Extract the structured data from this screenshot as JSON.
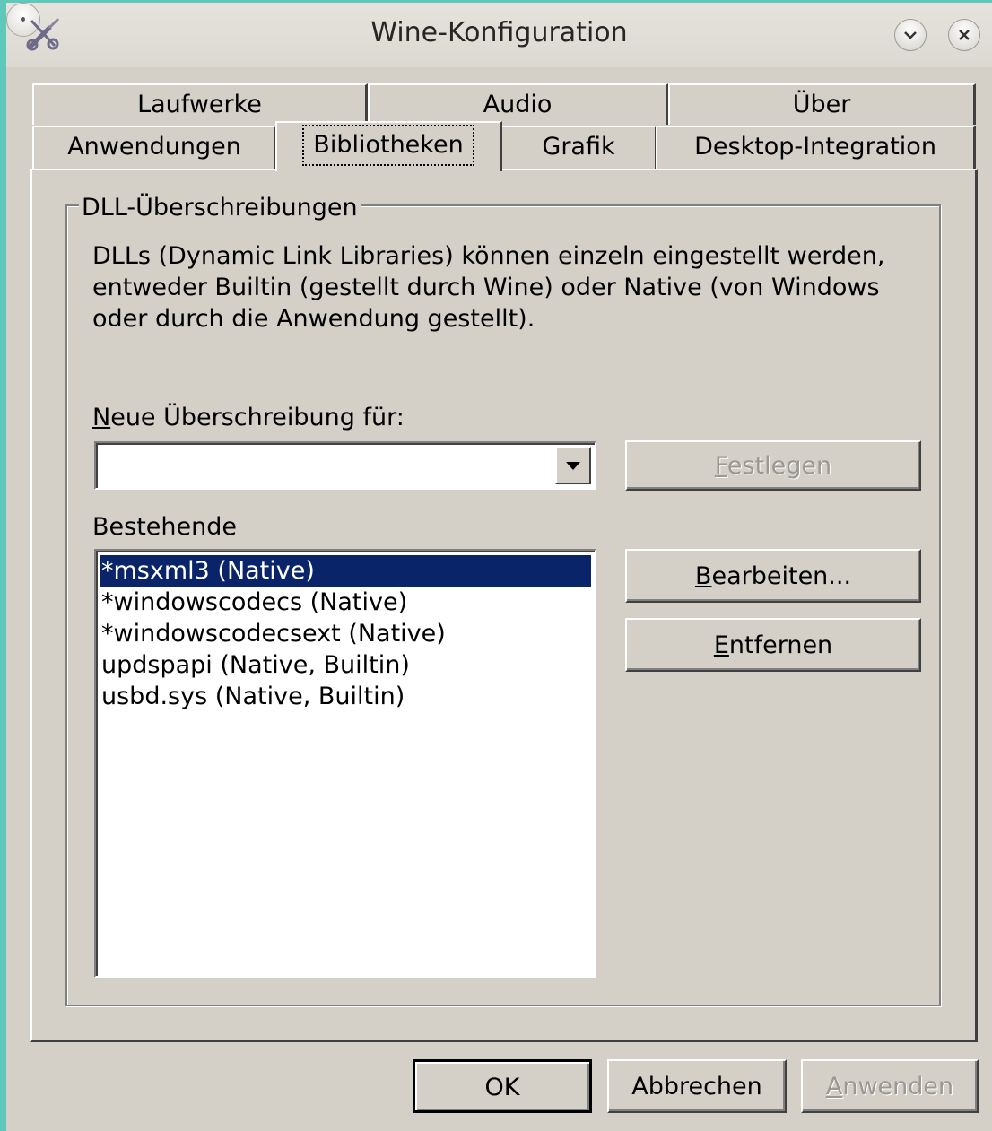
{
  "window": {
    "title": "Wine-Konfiguration",
    "icons": {
      "app": "tools-icon",
      "menu": "circle-menu-icon",
      "minimize": "chevron-down-icon",
      "close": "close-icon"
    },
    "accent_color": "#5ec9ba"
  },
  "tabs": {
    "row1": [
      "Laufwerke",
      "Audio",
      "Über"
    ],
    "row2": [
      "Anwendungen",
      "Bibliotheken",
      "Grafik",
      "Desktop-Integration"
    ],
    "active": "Bibliotheken"
  },
  "dll_overrides": {
    "group_title": "DLL-Überschreibungen",
    "description": "DLLs (Dynamic Link Libraries) können einzeln eingestellt werden, entweder Builtin (gestellt durch Wine) oder Native (von Windows oder durch die Anwendung gestellt).",
    "new_label_accel": "N",
    "new_label_rest": "eue Überschreibung für:",
    "combo_value": "",
    "set_accel": "F",
    "set_rest": "estlegen",
    "existing_label": "Bestehende",
    "items": [
      "*msxml3 (Native)",
      "*windowscodecs (Native)",
      "*windowscodecsext (Native)",
      "updspapi (Native, Builtin)",
      "usbd.sys (Native, Builtin)"
    ],
    "selected_index": 0,
    "edit_accel": "B",
    "edit_rest": "earbeiten...",
    "remove_accel": "E",
    "remove_rest": "ntfernen",
    "selection_color": "#0a246a"
  },
  "footer": {
    "ok": "OK",
    "cancel": "Abbrechen",
    "apply_accel": "A",
    "apply_rest": "nwenden"
  }
}
